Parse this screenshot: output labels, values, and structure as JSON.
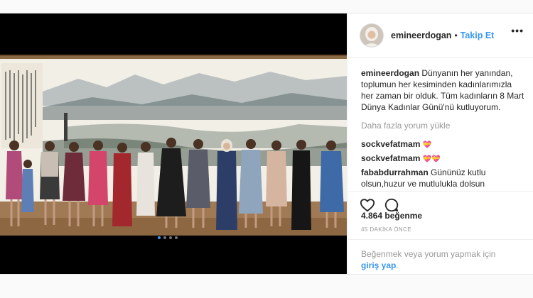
{
  "post": {
    "username": "emineerdogan",
    "separator": "•",
    "follow_label": "Takip Et",
    "caption_user": "emineerdogan",
    "caption_text": "Dünyanın her yanından, toplumun her kesiminden kadınlarımızla her zaman bir olduk. Tüm kadınların 8 Mart Dünya Kadınlar Günü'nü kutluyorum.",
    "load_more": "Daha fazla yorum yükle",
    "comments": [
      {
        "user": "sockvefatmam",
        "text": "💝"
      },
      {
        "user": "sockvefatmam",
        "text": "💝💝"
      },
      {
        "user": "fababdurrahman",
        "text": "Gününüz kutlu olsun,huzur ve mutlulukla dolsun"
      }
    ],
    "likes": "4.864 beğenme",
    "time": "45 DAKİKA ÖNCE",
    "login_prompt": "Beğenmek veya yorum yapmak için",
    "login_link": "giriş yap",
    "login_end": ".",
    "more_menu": "•••"
  },
  "media": {
    "carousel_count": 4,
    "carousel_active": 1
  },
  "icons": {
    "like": "heart-icon",
    "comment": "comment-icon",
    "avatar": "profile-avatar"
  },
  "colors": {
    "link": "#3897f0",
    "text": "#262626",
    "muted": "#999999"
  }
}
